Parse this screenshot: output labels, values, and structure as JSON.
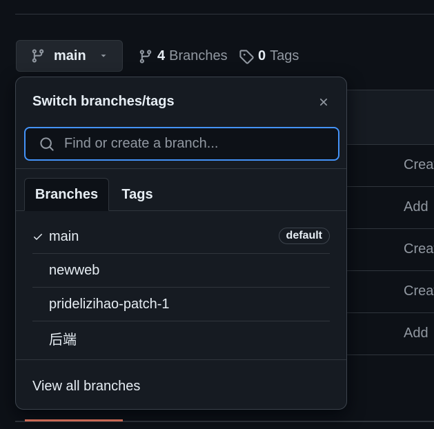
{
  "repo_bar": {
    "current_branch": "main",
    "branches_count": "4",
    "branches_label": "Branches",
    "tags_count": "0",
    "tags_label": "Tags"
  },
  "background_rows": [
    "Creat",
    "Add",
    "Creat",
    "Creat",
    "Add"
  ],
  "dropdown": {
    "title": "Switch branches/tags",
    "search_placeholder": "Find or create a branch...",
    "search_value": "",
    "tabs": [
      {
        "label": "Branches",
        "active": true
      },
      {
        "label": "Tags",
        "active": false
      }
    ],
    "branches": [
      {
        "name": "main",
        "selected": true,
        "badge": "default"
      },
      {
        "name": "newweb",
        "selected": false,
        "badge": ""
      },
      {
        "name": "pridelizihao-patch-1",
        "selected": false,
        "badge": ""
      },
      {
        "name": "后端",
        "selected": false,
        "badge": ""
      }
    ],
    "footer_link": "View all branches"
  },
  "colors": {
    "background": "#0d1117",
    "panel": "#161b22",
    "border": "#30363d",
    "focus_ring": "#4493f8",
    "muted_text": "#9198a1",
    "text": "#e6edf3",
    "underline_accent": "#f78166"
  },
  "icons": {
    "branch": "git-branch-icon",
    "caret": "caret-down-icon",
    "tag": "tag-icon",
    "close": "close-icon",
    "search": "search-icon",
    "check": "check-icon"
  }
}
